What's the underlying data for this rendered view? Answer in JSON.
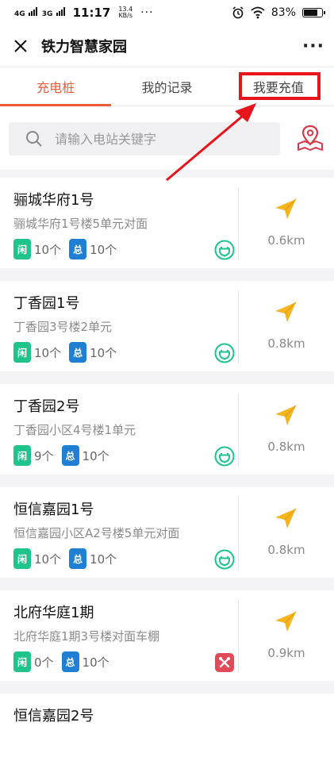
{
  "status_bar": {
    "signal_1": "4G",
    "signal_2": "3G",
    "time": "11:17",
    "speed_value": "13.4",
    "speed_unit": "KB/s",
    "more": "···",
    "battery_percent": "83%",
    "battery_level": 0.83
  },
  "titlebar": {
    "title": "铁力智慧家园",
    "more": "···"
  },
  "tabs": [
    {
      "label": "充电桩",
      "active": true
    },
    {
      "label": "我的记录",
      "active": false
    },
    {
      "label": "我要充值",
      "active": false
    }
  ],
  "search": {
    "placeholder": "请输入电站关键字"
  },
  "colors": {
    "accent": "#ec5a3a",
    "highlight_box": "#e8141b",
    "idle_badge": "#1ec48a",
    "total_badge": "#1e7fd3",
    "nav_arrow": "#f5b51e"
  },
  "badges": {
    "idle": "闲",
    "total": "总"
  },
  "stations": [
    {
      "name": "骊城华府1号",
      "address": "骊城华府1号楼5单元对面",
      "idle": "10个",
      "total": "10个",
      "distance": "0.6km",
      "status": "plug-icon"
    },
    {
      "name": "丁香园1号",
      "address": "丁香园3号楼2单元",
      "idle": "10个",
      "total": "10个",
      "distance": "0.8km",
      "status": "plug-icon"
    },
    {
      "name": "丁香园2号",
      "address": "丁香园小区4号楼1单元",
      "idle": "9个",
      "total": "10个",
      "distance": "0.8km",
      "status": "plug-icon"
    },
    {
      "name": "恒信嘉园1号",
      "address": "恒信嘉园小区A2号楼5单元对面",
      "idle": "10个",
      "total": "10个",
      "distance": "0.8km",
      "status": "plug-icon"
    },
    {
      "name": "北府华庭1期",
      "address": "北府华庭1期3号楼对面车棚",
      "idle": "0个",
      "total": "10个",
      "distance": "0.9km",
      "status": "maintenance-icon"
    },
    {
      "name": "恒信嘉园2号",
      "address": "",
      "idle": "",
      "total": "",
      "distance": "",
      "status": ""
    }
  ]
}
